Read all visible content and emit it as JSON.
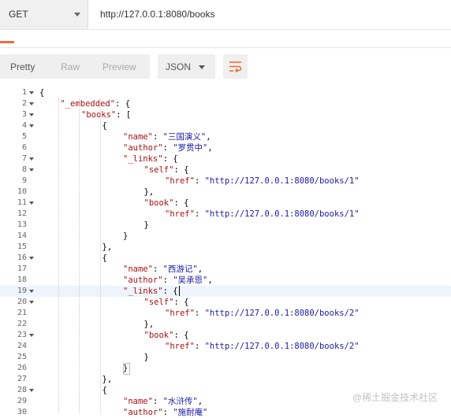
{
  "request": {
    "method": "GET",
    "url": "http://127.0.0.1:8080/books"
  },
  "response_toolbar": {
    "tabs": [
      "Pretty",
      "Raw",
      "Preview"
    ],
    "active_tab": "Pretty",
    "format": "JSON"
  },
  "editor": {
    "highlighted_line": 19,
    "lines": [
      {
        "n": "1",
        "fold": true,
        "indent": 0,
        "tokens": [
          {
            "t": "p",
            "v": "{"
          }
        ]
      },
      {
        "n": "2",
        "fold": true,
        "indent": 1,
        "tokens": [
          {
            "t": "k",
            "v": "\"_embedded\""
          },
          {
            "t": "p",
            "v": ": {"
          }
        ]
      },
      {
        "n": "3",
        "fold": true,
        "indent": 2,
        "tokens": [
          {
            "t": "k",
            "v": "\"books\""
          },
          {
            "t": "p",
            "v": ": ["
          }
        ]
      },
      {
        "n": "4",
        "fold": true,
        "indent": 3,
        "tokens": [
          {
            "t": "p",
            "v": "{"
          }
        ]
      },
      {
        "n": "5",
        "fold": false,
        "indent": 4,
        "tokens": [
          {
            "t": "k",
            "v": "\"name\""
          },
          {
            "t": "p",
            "v": ": "
          },
          {
            "t": "s",
            "v": "\"三国演义\""
          },
          {
            "t": "p",
            "v": ","
          }
        ]
      },
      {
        "n": "6",
        "fold": false,
        "indent": 4,
        "tokens": [
          {
            "t": "k",
            "v": "\"author\""
          },
          {
            "t": "p",
            "v": ": "
          },
          {
            "t": "s",
            "v": "\"罗贯中\""
          },
          {
            "t": "p",
            "v": ","
          }
        ]
      },
      {
        "n": "7",
        "fold": true,
        "indent": 4,
        "tokens": [
          {
            "t": "k",
            "v": "\"_links\""
          },
          {
            "t": "p",
            "v": ": {"
          }
        ]
      },
      {
        "n": "8",
        "fold": true,
        "indent": 5,
        "tokens": [
          {
            "t": "k",
            "v": "\"self\""
          },
          {
            "t": "p",
            "v": ": {"
          }
        ]
      },
      {
        "n": "9",
        "fold": false,
        "indent": 6,
        "tokens": [
          {
            "t": "k",
            "v": "\"href\""
          },
          {
            "t": "p",
            "v": ": "
          },
          {
            "t": "s",
            "v": "\"http://127.0.0.1:8080/books/1\""
          }
        ]
      },
      {
        "n": "10",
        "fold": false,
        "indent": 5,
        "tokens": [
          {
            "t": "p",
            "v": "},"
          }
        ]
      },
      {
        "n": "11",
        "fold": true,
        "indent": 5,
        "tokens": [
          {
            "t": "k",
            "v": "\"book\""
          },
          {
            "t": "p",
            "v": ": {"
          }
        ]
      },
      {
        "n": "12",
        "fold": false,
        "indent": 6,
        "tokens": [
          {
            "t": "k",
            "v": "\"href\""
          },
          {
            "t": "p",
            "v": ": "
          },
          {
            "t": "s",
            "v": "\"http://127.0.0.1:8080/books/1\""
          }
        ]
      },
      {
        "n": "13",
        "fold": false,
        "indent": 5,
        "tokens": [
          {
            "t": "p",
            "v": "}"
          }
        ]
      },
      {
        "n": "14",
        "fold": false,
        "indent": 4,
        "tokens": [
          {
            "t": "p",
            "v": "}"
          }
        ]
      },
      {
        "n": "15",
        "fold": false,
        "indent": 3,
        "tokens": [
          {
            "t": "p",
            "v": "},"
          }
        ]
      },
      {
        "n": "16",
        "fold": true,
        "indent": 3,
        "tokens": [
          {
            "t": "p",
            "v": "{"
          }
        ]
      },
      {
        "n": "17",
        "fold": false,
        "indent": 4,
        "tokens": [
          {
            "t": "k",
            "v": "\"name\""
          },
          {
            "t": "p",
            "v": ": "
          },
          {
            "t": "s",
            "v": "\"西游记\""
          },
          {
            "t": "p",
            "v": ","
          }
        ]
      },
      {
        "n": "18",
        "fold": false,
        "indent": 4,
        "tokens": [
          {
            "t": "k",
            "v": "\"author\""
          },
          {
            "t": "p",
            "v": ": "
          },
          {
            "t": "s",
            "v": "\"吴承恩\""
          },
          {
            "t": "p",
            "v": ","
          }
        ]
      },
      {
        "n": "19",
        "fold": true,
        "indent": 4,
        "tokens": [
          {
            "t": "k",
            "v": "\"_links\""
          },
          {
            "t": "p",
            "v": ": {"
          }
        ]
      },
      {
        "n": "20",
        "fold": true,
        "indent": 5,
        "tokens": [
          {
            "t": "k",
            "v": "\"self\""
          },
          {
            "t": "p",
            "v": ": {"
          }
        ]
      },
      {
        "n": "21",
        "fold": false,
        "indent": 6,
        "tokens": [
          {
            "t": "k",
            "v": "\"href\""
          },
          {
            "t": "p",
            "v": ": "
          },
          {
            "t": "s",
            "v": "\"http://127.0.0.1:8080/books/2\""
          }
        ]
      },
      {
        "n": "22",
        "fold": false,
        "indent": 5,
        "tokens": [
          {
            "t": "p",
            "v": "},"
          }
        ]
      },
      {
        "n": "23",
        "fold": true,
        "indent": 5,
        "tokens": [
          {
            "t": "k",
            "v": "\"book\""
          },
          {
            "t": "p",
            "v": ": {"
          }
        ]
      },
      {
        "n": "24",
        "fold": false,
        "indent": 6,
        "tokens": [
          {
            "t": "k",
            "v": "\"href\""
          },
          {
            "t": "p",
            "v": ": "
          },
          {
            "t": "s",
            "v": "\"http://127.0.0.1:8080/books/2\""
          }
        ]
      },
      {
        "n": "25",
        "fold": false,
        "indent": 5,
        "tokens": [
          {
            "t": "p",
            "v": "}"
          }
        ]
      },
      {
        "n": "26",
        "fold": false,
        "indent": 4,
        "tokens": [
          {
            "t": "p",
            "v": "}"
          }
        ]
      },
      {
        "n": "27",
        "fold": false,
        "indent": 3,
        "tokens": [
          {
            "t": "p",
            "v": "},"
          }
        ]
      },
      {
        "n": "28",
        "fold": true,
        "indent": 3,
        "tokens": [
          {
            "t": "p",
            "v": "{"
          }
        ]
      },
      {
        "n": "29",
        "fold": false,
        "indent": 4,
        "tokens": [
          {
            "t": "k",
            "v": "\"name\""
          },
          {
            "t": "p",
            "v": ": "
          },
          {
            "t": "s",
            "v": "\"水浒传\""
          },
          {
            "t": "p",
            "v": ","
          }
        ]
      },
      {
        "n": "30",
        "fold": false,
        "indent": 4,
        "tokens": [
          {
            "t": "k",
            "v": "\"author\""
          },
          {
            "t": "p",
            "v": ": "
          },
          {
            "t": "s",
            "v": "\"施耐庵\""
          }
        ]
      }
    ]
  },
  "watermark": "@稀土掘金技术社区",
  "colors": {
    "accent": "#f26b3a",
    "key": "#aa1111",
    "string": "#1a1aa6",
    "line_highlight": "#eef4fb"
  },
  "icons": {
    "method_dropdown": "chevron-down-icon",
    "format_dropdown": "chevron-down-icon",
    "wrap": "wrap-lines-icon",
    "fold": "fold-arrow-icon"
  }
}
